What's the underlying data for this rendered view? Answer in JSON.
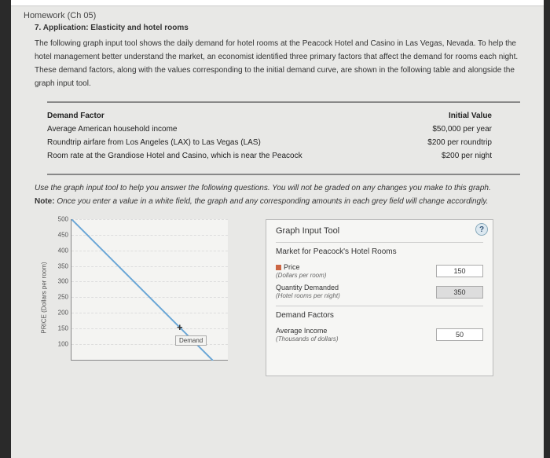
{
  "header": {
    "homework": "Homework (Ch 05)",
    "problem": "7. Application: Elasticity and hotel rooms"
  },
  "intro": "The following graph input tool shows the daily demand for hotel rooms at the Peacock Hotel and Casino in Las Vegas, Nevada. To help the hotel management better understand the market, an economist identified three primary factors that affect the demand for rooms each night. These demand factors, along with the values corresponding to the initial demand curve, are shown in the following table and alongside the graph input tool.",
  "factors": {
    "header_left": "Demand Factor",
    "header_right": "Initial Value",
    "rows": [
      {
        "left": "Average American household income",
        "right": "$50,000 per year"
      },
      {
        "left": "Roundtrip airfare from Los Angeles (LAX) to Las Vegas (LAS)",
        "right": "$200 per roundtrip"
      },
      {
        "left": "Room rate at the Grandiose Hotel and Casino, which is near the Peacock",
        "right": "$200 per night"
      }
    ]
  },
  "instructions": {
    "line1": "Use the graph input tool to help you answer the following questions. You will not be graded on any changes you make to this graph.",
    "note_label": "Note:",
    "line2": "Once you enter a value in a white field, the graph and any corresponding amounts in each grey field will change accordingly."
  },
  "chart_data": {
    "type": "line",
    "ylabel": "PRICE (Dollars per room)",
    "y_ticks": [
      100,
      150,
      200,
      250,
      300,
      350,
      400,
      450,
      500
    ],
    "ylim": [
      50,
      500
    ],
    "series": [
      {
        "name": "Demand",
        "points": [
          [
            0,
            500
          ],
          [
            450,
            50
          ]
        ]
      }
    ],
    "legend_label": "Demand"
  },
  "tool": {
    "title": "Graph Input Tool",
    "market_title": "Market for Peacock's Hotel Rooms",
    "price": {
      "label": "Price",
      "sub": "(Dollars per room)",
      "value": "150"
    },
    "quantity": {
      "label": "Quantity Demanded",
      "sub": "(Hotel rooms per night)",
      "value": "350"
    },
    "factors_title": "Demand Factors",
    "income": {
      "label": "Average Income",
      "sub": "(Thousands of dollars)",
      "value": "50"
    }
  }
}
